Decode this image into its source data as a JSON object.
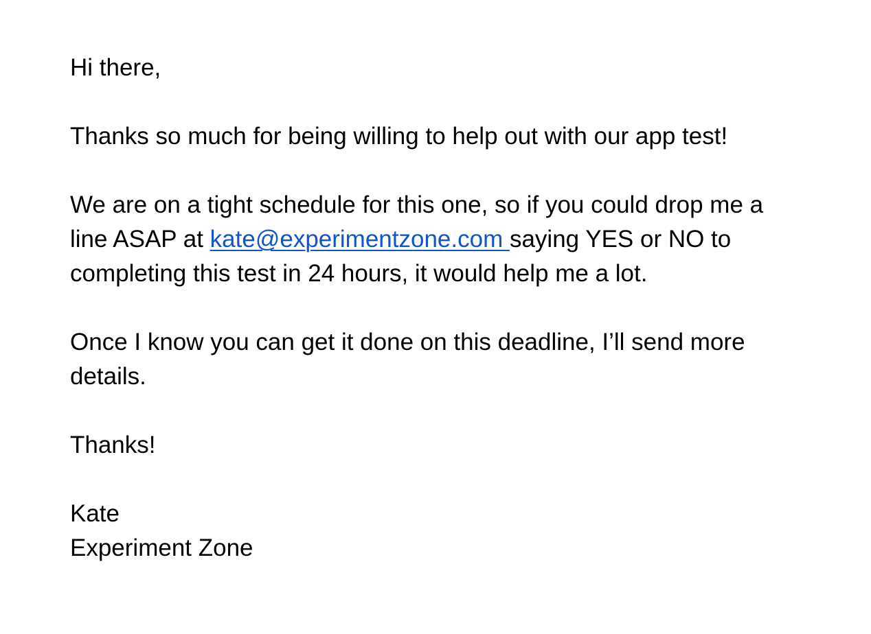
{
  "email": {
    "greeting": "Hi there,",
    "paragraph1": "Thanks so much for being willing to help out with our app test!",
    "paragraph2": {
      "before_link": "We are on a tight schedule for this one, so if you could drop me a line ASAP at ",
      "link_text": "kate@experimentzone.com ",
      "after_link": "saying YES or NO to completing this test in 24 hours, it would help me a lot."
    },
    "paragraph3": "Once I know you can get it done on this deadline, I’ll send more details.",
    "closing": "Thanks!",
    "signature": {
      "name": "Kate",
      "company": "Experiment Zone"
    }
  },
  "colors": {
    "text": "#000000",
    "link": "#1155cc",
    "background": "#ffffff"
  }
}
